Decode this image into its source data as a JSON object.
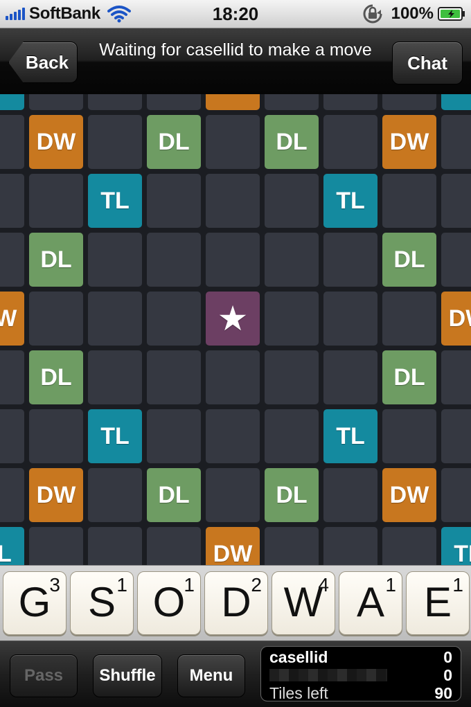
{
  "status_bar": {
    "carrier": "SoftBank",
    "time": "18:20",
    "battery_percent": "100%",
    "signal_bars": 5,
    "signal_color": "#1b54c6"
  },
  "nav": {
    "back_label": "Back",
    "title": "Waiting for casellid to make a move",
    "chat_label": "Chat"
  },
  "board": {
    "colors": {
      "DW": "#c8771f",
      "DL": "#6e9c63",
      "TL": "#148a9f",
      "STAR": "#6c3f63",
      "empty": "#353841"
    },
    "rows": [
      [
        "TL",
        "",
        "",
        "",
        "DW",
        "",
        "",
        "",
        "TL"
      ],
      [
        "",
        "DW",
        "",
        "DL",
        "",
        "DL",
        "",
        "DW",
        ""
      ],
      [
        "",
        "",
        "TL",
        "",
        "",
        "",
        "TL",
        "",
        ""
      ],
      [
        "",
        "DL",
        "",
        "",
        "",
        "",
        "",
        "DL",
        ""
      ],
      [
        "DW",
        "",
        "",
        "",
        "STAR",
        "",
        "",
        "",
        "DW"
      ],
      [
        "",
        "DL",
        "",
        "",
        "",
        "",
        "",
        "DL",
        ""
      ],
      [
        "",
        "",
        "TL",
        "",
        "",
        "",
        "TL",
        "",
        ""
      ],
      [
        "",
        "DW",
        "",
        "DL",
        "",
        "DL",
        "",
        "DW",
        ""
      ],
      [
        "TL",
        "",
        "",
        "",
        "DW",
        "",
        "",
        "",
        "TL"
      ]
    ],
    "star_glyph": "★"
  },
  "rack": [
    {
      "letter": "G",
      "score": "3"
    },
    {
      "letter": "S",
      "score": "1"
    },
    {
      "letter": "O",
      "score": "1"
    },
    {
      "letter": "D",
      "score": "2"
    },
    {
      "letter": "W",
      "score": "4"
    },
    {
      "letter": "A",
      "score": "1"
    },
    {
      "letter": "E",
      "score": "1"
    }
  ],
  "toolbar": {
    "pass_label": "Pass",
    "shuffle_label": "Shuffle",
    "menu_label": "Menu"
  },
  "scores": {
    "player1_name": "casellid",
    "player1_score": "0",
    "player2_score": "0",
    "tiles_left_label": "Tiles left",
    "tiles_left": "90"
  }
}
